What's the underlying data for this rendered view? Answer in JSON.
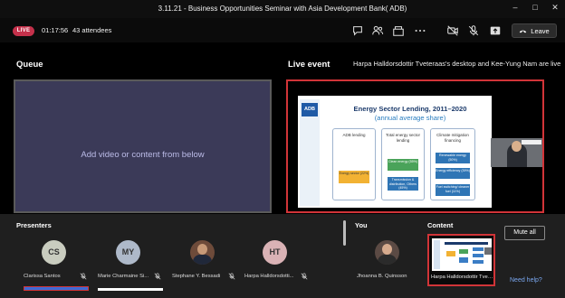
{
  "window": {
    "title": "3.11.21 - Business Opportunities Seminar with Asia Development Bank( ADB)",
    "controls": [
      "–",
      "□",
      "✕"
    ]
  },
  "meeting_bar": {
    "live_badge": "LIVE",
    "elapsed": "01:17:56",
    "attendees": "43 attendees",
    "icons": [
      "chat-icon",
      "people-icon",
      "more-icon",
      "camera-off-icon",
      "mic-off-icon",
      "share-icon"
    ],
    "leave_label": "Leave",
    "colors": {
      "live": "#c4314b"
    }
  },
  "queue": {
    "title": "Queue",
    "placeholder": "Add video or content from below"
  },
  "live_event": {
    "title": "Live event",
    "caption": "Harpa Halldorsdottir Tveteraas's desktop and Kee-Yung Nam are live",
    "slide": {
      "logo": "ADB",
      "title": "Energy Sector Lending, 2011–2020",
      "subtitle": "(annual average share)",
      "columns": [
        {
          "label": "ADB lending"
        },
        {
          "label": "Total energy sector lending"
        },
        {
          "label": "Climate mitigation financing"
        }
      ],
      "chips": [
        "Energy sector (22%)",
        "Clean energy (55%)",
        "Transmission & distribution, Others (45%)",
        "Renewable energy (50%)",
        "Energy efficiency (39%)",
        "Fuel switching/ cleaner fuel (11%)"
      ]
    }
  },
  "presenters": {
    "title": "Presenters",
    "items": [
      {
        "initials": "CS",
        "name": "Clarissa Santos",
        "color": "#c9ccbf"
      },
      {
        "initials": "MY",
        "name": "Marie Charmaine Si...",
        "color": "#aeb9c9"
      },
      {
        "initials": "",
        "name": "Stephane Y. Bessadi",
        "color": "#6e4b3a"
      },
      {
        "initials": "HT",
        "name": "Harpa Halldorsdotti...",
        "color": "#d9b2b5"
      }
    ]
  },
  "you": {
    "title": "You",
    "name": "Jhoanna B. Quinsson"
  },
  "content": {
    "title": "Content",
    "name": "Harpa Halldorsdottir Tvete..."
  },
  "actions": {
    "mute_all": "Mute all",
    "help": "Need help?"
  }
}
